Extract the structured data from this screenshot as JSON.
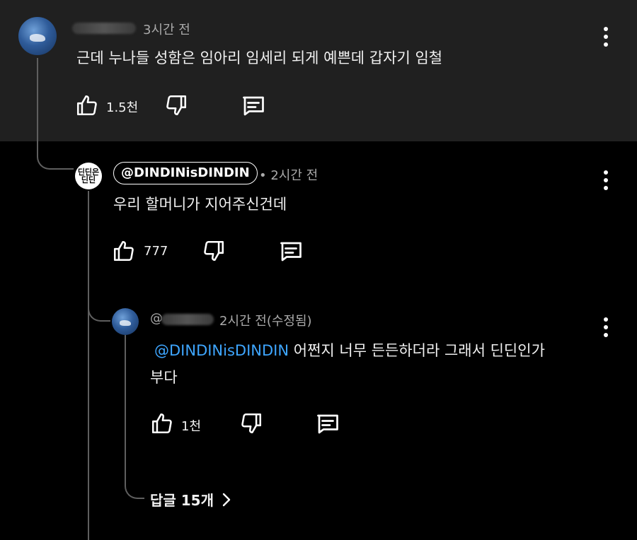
{
  "comment1": {
    "time": "3시간 전",
    "text": "근데 누나들 성함은 임아리 임세리 되게 예쁜데 갑자기 임철",
    "likes": "1.5천"
  },
  "reply1": {
    "author": "@DINDINisDINDIN",
    "avatar_text": "딘딘은\n딘딘",
    "time": "• 2시간 전",
    "text": "우리 할머니가 지어주신건데",
    "likes": "777"
  },
  "reply2": {
    "author_prefix": "@",
    "time": "2시간 전(수정됨)",
    "mention": "@DINDINisDINDIN",
    "text_line1": " 어쩐지 너무 든든하더라 그래서 딘딘인가",
    "text_line2": "부다",
    "likes": "1천"
  },
  "replies_toggle": {
    "label": "답글 15개"
  },
  "colors": {
    "background_top": "#202020",
    "background": "#000000",
    "mention": "#3ea6ff",
    "text": "#f1f1f1",
    "meta": "#aaaaaa"
  }
}
